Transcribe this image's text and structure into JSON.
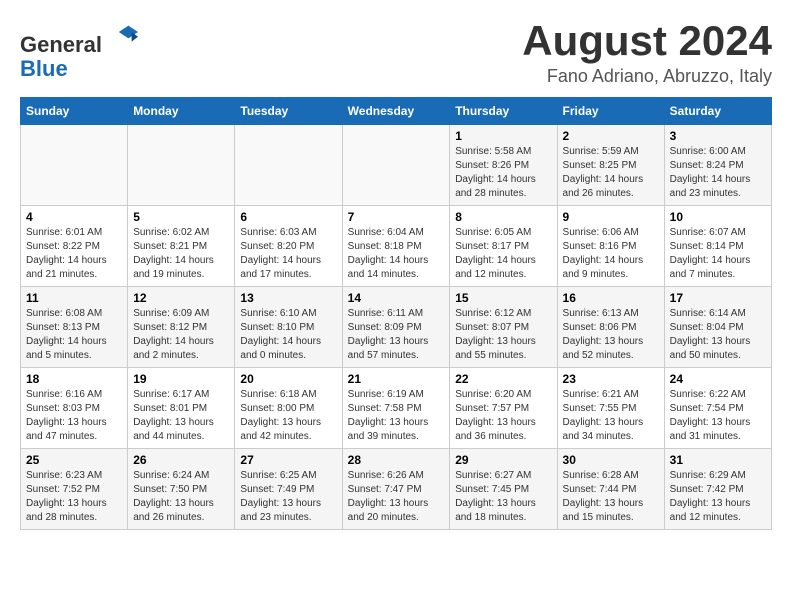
{
  "header": {
    "logo_line1": "General",
    "logo_line2": "Blue",
    "month": "August 2024",
    "location": "Fano Adriano, Abruzzo, Italy"
  },
  "weekdays": [
    "Sunday",
    "Monday",
    "Tuesday",
    "Wednesday",
    "Thursday",
    "Friday",
    "Saturday"
  ],
  "weeks": [
    [
      {
        "day": "",
        "info": ""
      },
      {
        "day": "",
        "info": ""
      },
      {
        "day": "",
        "info": ""
      },
      {
        "day": "",
        "info": ""
      },
      {
        "day": "1",
        "info": "Sunrise: 5:58 AM\nSunset: 8:26 PM\nDaylight: 14 hours and 28 minutes."
      },
      {
        "day": "2",
        "info": "Sunrise: 5:59 AM\nSunset: 8:25 PM\nDaylight: 14 hours and 26 minutes."
      },
      {
        "day": "3",
        "info": "Sunrise: 6:00 AM\nSunset: 8:24 PM\nDaylight: 14 hours and 23 minutes."
      }
    ],
    [
      {
        "day": "4",
        "info": "Sunrise: 6:01 AM\nSunset: 8:22 PM\nDaylight: 14 hours and 21 minutes."
      },
      {
        "day": "5",
        "info": "Sunrise: 6:02 AM\nSunset: 8:21 PM\nDaylight: 14 hours and 19 minutes."
      },
      {
        "day": "6",
        "info": "Sunrise: 6:03 AM\nSunset: 8:20 PM\nDaylight: 14 hours and 17 minutes."
      },
      {
        "day": "7",
        "info": "Sunrise: 6:04 AM\nSunset: 8:18 PM\nDaylight: 14 hours and 14 minutes."
      },
      {
        "day": "8",
        "info": "Sunrise: 6:05 AM\nSunset: 8:17 PM\nDaylight: 14 hours and 12 minutes."
      },
      {
        "day": "9",
        "info": "Sunrise: 6:06 AM\nSunset: 8:16 PM\nDaylight: 14 hours and 9 minutes."
      },
      {
        "day": "10",
        "info": "Sunrise: 6:07 AM\nSunset: 8:14 PM\nDaylight: 14 hours and 7 minutes."
      }
    ],
    [
      {
        "day": "11",
        "info": "Sunrise: 6:08 AM\nSunset: 8:13 PM\nDaylight: 14 hours and 5 minutes."
      },
      {
        "day": "12",
        "info": "Sunrise: 6:09 AM\nSunset: 8:12 PM\nDaylight: 14 hours and 2 minutes."
      },
      {
        "day": "13",
        "info": "Sunrise: 6:10 AM\nSunset: 8:10 PM\nDaylight: 14 hours and 0 minutes."
      },
      {
        "day": "14",
        "info": "Sunrise: 6:11 AM\nSunset: 8:09 PM\nDaylight: 13 hours and 57 minutes."
      },
      {
        "day": "15",
        "info": "Sunrise: 6:12 AM\nSunset: 8:07 PM\nDaylight: 13 hours and 55 minutes."
      },
      {
        "day": "16",
        "info": "Sunrise: 6:13 AM\nSunset: 8:06 PM\nDaylight: 13 hours and 52 minutes."
      },
      {
        "day": "17",
        "info": "Sunrise: 6:14 AM\nSunset: 8:04 PM\nDaylight: 13 hours and 50 minutes."
      }
    ],
    [
      {
        "day": "18",
        "info": "Sunrise: 6:16 AM\nSunset: 8:03 PM\nDaylight: 13 hours and 47 minutes."
      },
      {
        "day": "19",
        "info": "Sunrise: 6:17 AM\nSunset: 8:01 PM\nDaylight: 13 hours and 44 minutes."
      },
      {
        "day": "20",
        "info": "Sunrise: 6:18 AM\nSunset: 8:00 PM\nDaylight: 13 hours and 42 minutes."
      },
      {
        "day": "21",
        "info": "Sunrise: 6:19 AM\nSunset: 7:58 PM\nDaylight: 13 hours and 39 minutes."
      },
      {
        "day": "22",
        "info": "Sunrise: 6:20 AM\nSunset: 7:57 PM\nDaylight: 13 hours and 36 minutes."
      },
      {
        "day": "23",
        "info": "Sunrise: 6:21 AM\nSunset: 7:55 PM\nDaylight: 13 hours and 34 minutes."
      },
      {
        "day": "24",
        "info": "Sunrise: 6:22 AM\nSunset: 7:54 PM\nDaylight: 13 hours and 31 minutes."
      }
    ],
    [
      {
        "day": "25",
        "info": "Sunrise: 6:23 AM\nSunset: 7:52 PM\nDaylight: 13 hours and 28 minutes."
      },
      {
        "day": "26",
        "info": "Sunrise: 6:24 AM\nSunset: 7:50 PM\nDaylight: 13 hours and 26 minutes."
      },
      {
        "day": "27",
        "info": "Sunrise: 6:25 AM\nSunset: 7:49 PM\nDaylight: 13 hours and 23 minutes."
      },
      {
        "day": "28",
        "info": "Sunrise: 6:26 AM\nSunset: 7:47 PM\nDaylight: 13 hours and 20 minutes."
      },
      {
        "day": "29",
        "info": "Sunrise: 6:27 AM\nSunset: 7:45 PM\nDaylight: 13 hours and 18 minutes."
      },
      {
        "day": "30",
        "info": "Sunrise: 6:28 AM\nSunset: 7:44 PM\nDaylight: 13 hours and 15 minutes."
      },
      {
        "day": "31",
        "info": "Sunrise: 6:29 AM\nSunset: 7:42 PM\nDaylight: 13 hours and 12 minutes."
      }
    ]
  ]
}
